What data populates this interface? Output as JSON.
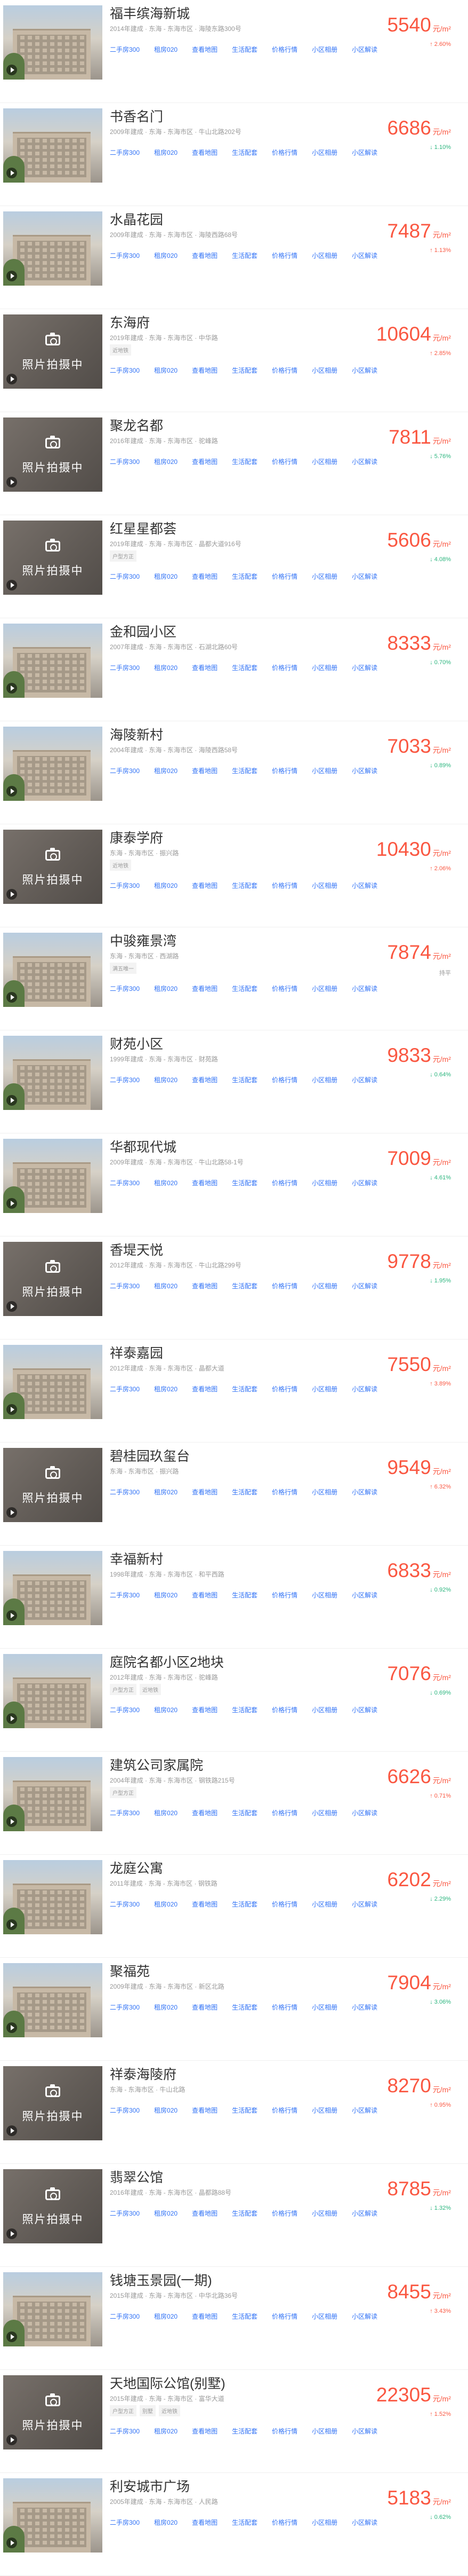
{
  "communities": [
    {
      "name": "福丰缤海新城",
      "meta": "2014年建成 · 东海 - 东海市区 · 海陵东路300号",
      "tags": [],
      "price": "5540",
      "unit": "元/m²",
      "change": "↑ 2.60%",
      "trend": "up",
      "photo": "photo"
    },
    {
      "name": "书香名门",
      "meta": "2009年建成 · 东海 - 东海市区 · 牛山北路202号",
      "tags": [],
      "price": "6686",
      "unit": "元/m²",
      "change": "↓ 1.10%",
      "trend": "down",
      "photo": "photo"
    },
    {
      "name": "水晶花园",
      "meta": "2009年建成 · 东海 - 东海市区 · 海陵西路68号",
      "tags": [],
      "price": "7487",
      "unit": "元/m²",
      "change": "↑ 1.13%",
      "trend": "up",
      "photo": "photo"
    },
    {
      "name": "东海府",
      "meta": "2019年建成 · 东海 - 东海市区 · 中华路",
      "tags": [
        "近地铁"
      ],
      "price": "10604",
      "unit": "元/m²",
      "change": "↑ 2.85%",
      "trend": "up",
      "photo": "placeholder"
    },
    {
      "name": "聚龙名都",
      "meta": "2016年建成 · 东海 - 东海市区 · 驼峰路",
      "tags": [],
      "price": "7811",
      "unit": "元/m²",
      "change": "↓ 5.76%",
      "trend": "down",
      "photo": "placeholder"
    },
    {
      "name": "红星星都荟",
      "meta": "2019年建成 · 东海 - 东海市区 · 晶都大道916号",
      "tags": [
        "户型方正"
      ],
      "price": "5606",
      "unit": "元/m²",
      "change": "↓ 4.08%",
      "trend": "down",
      "photo": "placeholder"
    },
    {
      "name": "金和园小区",
      "meta": "2007年建成 · 东海 - 东海市区 · 石湖北路60号",
      "tags": [],
      "price": "8333",
      "unit": "元/m²",
      "change": "↓ 0.70%",
      "trend": "down",
      "photo": "photo"
    },
    {
      "name": "海陵新村",
      "meta": "2004年建成 · 东海 - 东海市区 · 海陵西路58号",
      "tags": [],
      "price": "7033",
      "unit": "元/m²",
      "change": "↓ 0.89%",
      "trend": "down",
      "photo": "photo"
    },
    {
      "name": "康泰学府",
      "meta": "东海 - 东海市区 · 振兴路",
      "tags": [
        "近地铁"
      ],
      "price": "10430",
      "unit": "元/m²",
      "change": "↑ 2.06%",
      "trend": "up",
      "photo": "placeholder"
    },
    {
      "name": "中骏雍景湾",
      "meta": "东海 - 东海市区 · 西湖路",
      "tags": [
        "满五唯一"
      ],
      "price": "7874",
      "unit": "元/m²",
      "change": "持平",
      "trend": "flat",
      "photo": "photo"
    },
    {
      "name": "财苑小区",
      "meta": "1999年建成 · 东海 - 东海市区 · 财苑路",
      "tags": [],
      "price": "9833",
      "unit": "元/m²",
      "change": "↓ 0.64%",
      "trend": "down",
      "photo": "photo"
    },
    {
      "name": "华都现代城",
      "meta": "2009年建成 · 东海 - 东海市区 · 牛山北路58-1号",
      "tags": [],
      "price": "7009",
      "unit": "元/m²",
      "change": "↓ 4.61%",
      "trend": "down",
      "photo": "photo"
    },
    {
      "name": "香堤天悦",
      "meta": "2012年建成 · 东海 - 东海市区 · 牛山北路299号",
      "tags": [],
      "price": "9778",
      "unit": "元/m²",
      "change": "↓ 1.95%",
      "trend": "down",
      "photo": "placeholder"
    },
    {
      "name": "祥泰嘉园",
      "meta": "2012年建成 · 东海 - 东海市区 · 晶都大道",
      "tags": [],
      "price": "7550",
      "unit": "元/m²",
      "change": "↑ 3.89%",
      "trend": "up",
      "photo": "photo"
    },
    {
      "name": "碧桂园玖玺台",
      "meta": "东海 - 东海市区 · 振兴路",
      "tags": [],
      "price": "9549",
      "unit": "元/m²",
      "change": "↑ 6.32%",
      "trend": "up",
      "photo": "placeholder"
    },
    {
      "name": "幸福新村",
      "meta": "1998年建成 · 东海 - 东海市区 · 和平西路",
      "tags": [],
      "price": "6833",
      "unit": "元/m²",
      "change": "↓ 0.92%",
      "trend": "down",
      "photo": "photo"
    },
    {
      "name": "庭院名都小区2地块",
      "meta": "2012年建成 · 东海 - 东海市区 · 驼峰路",
      "tags": [
        "户型方正",
        "近地铁"
      ],
      "price": "7076",
      "unit": "元/m²",
      "change": "↓ 0.69%",
      "trend": "down",
      "photo": "photo"
    },
    {
      "name": "建筑公司家属院",
      "meta": "2004年建成 · 东海 - 东海市区 · 钢铁路215号",
      "tags": [
        "户型方正"
      ],
      "price": "6626",
      "unit": "元/m²",
      "change": "↑ 0.71%",
      "trend": "up",
      "photo": "photo"
    },
    {
      "name": "龙庭公寓",
      "meta": "2011年建成 · 东海 - 东海市区 · 钢铁路",
      "tags": [],
      "price": "6202",
      "unit": "元/m²",
      "change": "↓ 2.29%",
      "trend": "down",
      "photo": "photo"
    },
    {
      "name": "聚福苑",
      "meta": "2009年建成 · 东海 - 东海市区 · 新区北路",
      "tags": [],
      "price": "7904",
      "unit": "元/m²",
      "change": "↓ 3.06%",
      "trend": "down",
      "photo": "photo"
    },
    {
      "name": "祥泰海陵府",
      "meta": "东海 - 东海市区 · 牛山北路",
      "tags": [],
      "price": "8270",
      "unit": "元/m²",
      "change": "↑ 0.95%",
      "trend": "up",
      "photo": "placeholder"
    },
    {
      "name": "翡翠公馆",
      "meta": "2016年建成 · 东海 - 东海市区 · 晶都路88号",
      "tags": [],
      "price": "8785",
      "unit": "元/m²",
      "change": "↓ 1.32%",
      "trend": "down",
      "photo": "placeholder"
    },
    {
      "name": "钱塘玉景园(一期)",
      "meta": "2015年建成 · 东海 - 东海市区 · 中华北路36号",
      "tags": [],
      "price": "8455",
      "unit": "元/m²",
      "change": "↑ 3.43%",
      "trend": "up",
      "photo": "photo"
    },
    {
      "name": "天地国际公馆(别墅)",
      "meta": "2015年建成 · 东海 - 东海市区 · 富华大道",
      "tags": [
        "户型方正",
        "别墅",
        "近地铁"
      ],
      "price": "22305",
      "unit": "元/m²",
      "change": "↑ 1.52%",
      "trend": "up",
      "photo": "placeholder"
    },
    {
      "name": "利安城市广场",
      "meta": "2005年建成 · 东海 - 东海市区 · 人民路",
      "tags": [],
      "price": "5183",
      "unit": "元/m²",
      "change": "↓ 0.62%",
      "trend": "down",
      "photo": "photo"
    }
  ],
  "action_links": [
    "二手房300",
    "租房020",
    "查看地图",
    "生活配套",
    "价格行情",
    "小区相册",
    "小区解读"
  ],
  "placeholder_text": "照片拍摄中",
  "colors": {
    "price": "#fa5741",
    "link": "#3072f6",
    "up": "#fa5741",
    "down": "#2ab57d",
    "muted": "#999999"
  }
}
